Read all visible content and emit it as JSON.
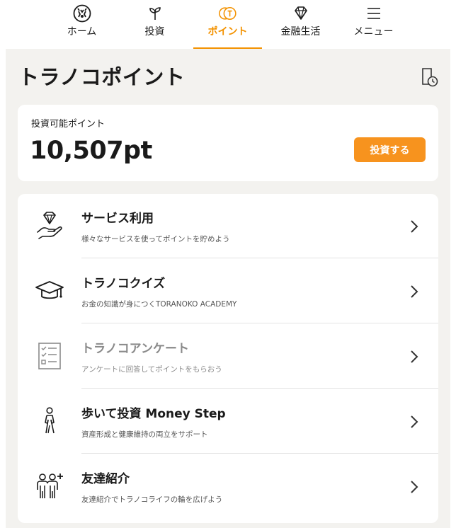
{
  "nav": {
    "items": [
      {
        "label": "ホーム",
        "icon": "tiger-logo-icon",
        "active": false
      },
      {
        "label": "投資",
        "icon": "sprout-icon",
        "active": false
      },
      {
        "label": "ポイント",
        "icon": "coins-icon",
        "active": true
      },
      {
        "label": "金融生活",
        "icon": "diamond-icon",
        "active": false
      },
      {
        "label": "メニュー",
        "icon": "hamburger-menu-icon",
        "active": false
      }
    ]
  },
  "page": {
    "title": "トラノコポイント",
    "history_icon": "history-document-icon"
  },
  "points": {
    "label": "投資可能ポイント",
    "value": "10,507pt",
    "invest_button": "投資する"
  },
  "menu": {
    "items": [
      {
        "title": "サービス利用",
        "subtitle": "様々なサービスを使ってポイントを貯めよう",
        "icon": "hand-diamond-icon",
        "disabled": false
      },
      {
        "title": "トラノコクイズ",
        "subtitle": "お金の知識が身につくTORANOKO ACADEMY",
        "icon": "graduation-cap-icon",
        "disabled": false
      },
      {
        "title": "トラノコアンケート",
        "subtitle": "アンケートに回答してポイントをもらおう",
        "icon": "checklist-icon",
        "disabled": true
      },
      {
        "title": "歩いて投資 Money Step",
        "subtitle": "資産形成と健康維持の両立をサポート",
        "icon": "walking-person-icon",
        "disabled": false
      },
      {
        "title": "友達紹介",
        "subtitle": "友達紹介でトラノコライフの輪を広げよう",
        "icon": "friends-add-icon",
        "disabled": false
      }
    ]
  },
  "colors": {
    "accent": "#f39200",
    "button": "#f7931e",
    "background": "#f3f2ef"
  }
}
